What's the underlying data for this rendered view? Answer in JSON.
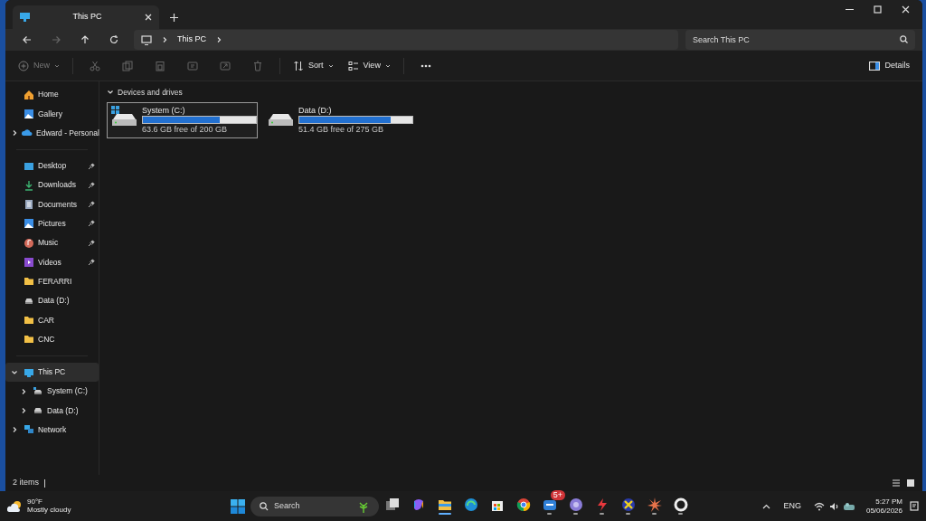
{
  "tabs": [
    {
      "label": "This PC",
      "selected": true
    }
  ],
  "address": {
    "crumbs": [
      "This PC"
    ]
  },
  "search": {
    "placeholder": "Search This PC"
  },
  "toolbar": {
    "buttons": [
      {
        "label": "New",
        "kind": "new",
        "disabled": true
      },
      {
        "label": "Sort",
        "kind": "sort",
        "disabled": false
      },
      {
        "label": "View",
        "kind": "view",
        "disabled": false
      }
    ],
    "details": "Details"
  },
  "sidebar": {
    "top": [
      {
        "label": "Home",
        "kind": "home"
      },
      {
        "label": "Gallery",
        "kind": "gallery"
      },
      {
        "label": "Edward - Personal",
        "kind": "cloud",
        "expanded": false
      }
    ],
    "quick": [
      {
        "label": "Desktop",
        "kind": "desktop",
        "pinned": true
      },
      {
        "label": "Downloads",
        "kind": "downloads",
        "pinned": true
      },
      {
        "label": "Documents",
        "kind": "documents",
        "pinned": true
      },
      {
        "label": "Pictures",
        "kind": "pictures",
        "pinned": true
      },
      {
        "label": "Music",
        "kind": "music",
        "pinned": true
      },
      {
        "label": "Videos",
        "kind": "videos",
        "pinned": true
      },
      {
        "label": "FERARRI",
        "kind": "folder",
        "pinned": false
      },
      {
        "label": "Data (D:)",
        "kind": "drive",
        "pinned": false
      },
      {
        "label": "CAR",
        "kind": "folder",
        "pinned": false
      },
      {
        "label": "CNC",
        "kind": "folder",
        "pinned": false
      }
    ],
    "tree": [
      {
        "label": "This PC",
        "kind": "pc",
        "expanded": true,
        "selected": true,
        "children": [
          {
            "label": "System (C:)",
            "kind": "sysdrive",
            "expanded": false,
            "selected": false
          },
          {
            "label": "Data (D:)",
            "kind": "drive",
            "expanded": false,
            "selected": false
          }
        ]
      },
      {
        "label": "Network",
        "kind": "network",
        "expanded": false,
        "selected": false
      }
    ]
  },
  "section": {
    "title": "Devices and drives",
    "expanded": true
  },
  "drives": [
    {
      "name": "System (C:)",
      "kind": "system",
      "level": 0.68,
      "free": "63.6 GB free of 200 GB",
      "selected": true
    },
    {
      "name": "Data (D:)",
      "kind": "data",
      "level": 0.81,
      "free": "51.4 GB free of 275 GB",
      "selected": false
    }
  ],
  "status_bar": {
    "count": "2 items"
  },
  "taskbar": {
    "weather": {
      "temp": "90°F",
      "condition": "Mostly cloudy"
    },
    "search": {
      "placeholder": "Search"
    },
    "apps": [
      {
        "kind": "taskview",
        "running": false,
        "active": false
      },
      {
        "kind": "copilot",
        "running": false,
        "active": false
      },
      {
        "kind": "explorer",
        "running": true,
        "active": true
      },
      {
        "kind": "edge",
        "running": false,
        "active": false
      },
      {
        "kind": "store",
        "running": false,
        "active": false
      },
      {
        "kind": "chrome",
        "running": false,
        "active": false
      },
      {
        "kind": "mail",
        "running": true,
        "active": false,
        "badge": "5+"
      },
      {
        "kind": "torrent",
        "running": true,
        "active": false
      },
      {
        "kind": "bolt",
        "running": true,
        "active": false
      },
      {
        "kind": "xapp",
        "running": true,
        "active": false
      },
      {
        "kind": "burst",
        "running": true,
        "active": false
      },
      {
        "kind": "ring",
        "running": true,
        "active": false
      }
    ],
    "language": "ENG",
    "time": "5:27 PM",
    "date": "05/06/2026"
  }
}
